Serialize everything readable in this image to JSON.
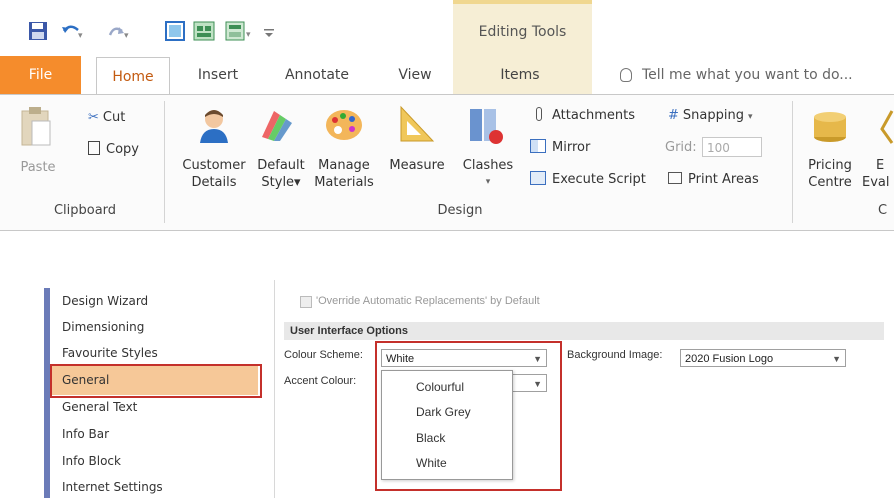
{
  "quick_access": {
    "icons": [
      "save-icon",
      "undo-icon",
      "redo-icon",
      "select-icon",
      "window-icon",
      "layout-icon",
      "customize-icon"
    ]
  },
  "contextual": {
    "label": "Editing Tools"
  },
  "tabs": [
    "File",
    "Home",
    "Insert",
    "Annotate",
    "View",
    "Items"
  ],
  "tell_me": "Tell me what you want to do...",
  "ribbon": {
    "clipboard": {
      "paste": "Paste",
      "cut": "Cut",
      "copy": "Copy",
      "label": "Clipboard"
    },
    "design": {
      "customer_details": [
        "Customer",
        "Details"
      ],
      "default_style": [
        "Default",
        "Style▾"
      ],
      "manage_materials": [
        "Manage",
        "Materials"
      ],
      "measure": "Measure",
      "clashes": "Clashes",
      "attachments": "Attachments",
      "mirror": "Mirror",
      "execute_script": "Execute Script",
      "snapping": "Snapping",
      "grid_label": "Grid:",
      "grid_value": "100",
      "print_areas": "Print Areas",
      "label": "Design"
    },
    "costing": {
      "pricing_centre": [
        "Pricing",
        "Centre"
      ],
      "eval_partial": [
        "E",
        "Eval"
      ],
      "label_partial": "C"
    }
  },
  "sidebar": {
    "items": [
      "Design Wizard",
      "Dimensioning",
      "Favourite Styles",
      "General",
      "General Text",
      "Info Bar",
      "Info Block",
      "Internet Settings"
    ],
    "selected": "General"
  },
  "panel": {
    "override_text": "'Override Automatic Replacements' by Default",
    "section_title": "User Interface Options",
    "colour_scheme_label": "Colour Scheme:",
    "colour_scheme_value": "White",
    "accent_label": "Accent Colour:",
    "background_label": "Background Image:",
    "background_value": "2020 Fusion Logo",
    "dropdown_options": [
      "Colourful",
      "Dark Grey",
      "Black",
      "White"
    ]
  },
  "colors": {
    "file_tab": "#f58c2c",
    "highlight": "#f6c898",
    "annotation_red": "#c4302b",
    "contextual": "#f6eed5"
  }
}
